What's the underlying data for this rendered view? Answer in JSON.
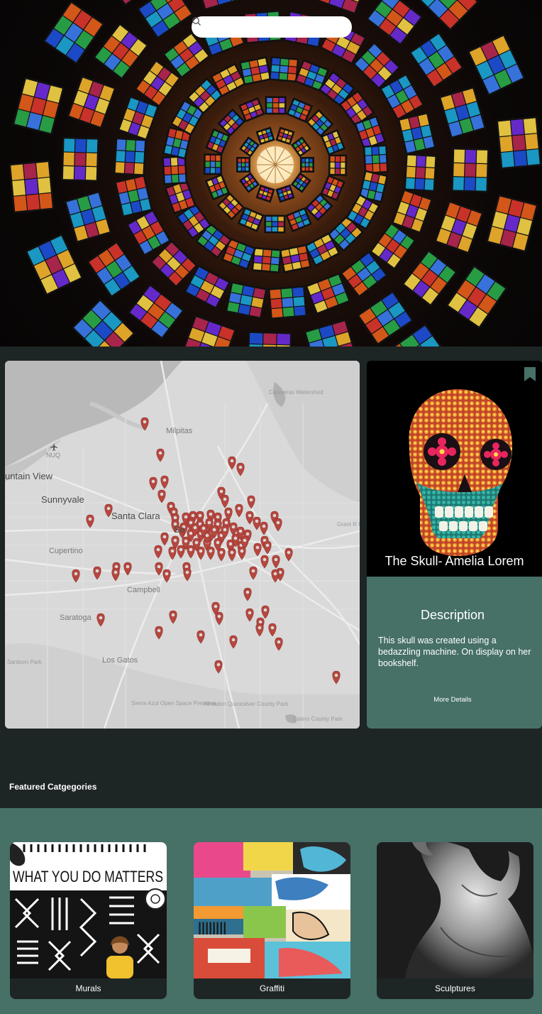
{
  "search": {
    "placeholder": "",
    "value": ""
  },
  "map": {
    "labels": {
      "calaveras": "Calaveras Watershed",
      "milpitas": "Milpitas",
      "nuq": "NUQ",
      "mountain_view": "untain View",
      "sunnyvale": "Sunnyvale",
      "santa_clara": "Santa Clara",
      "san_jose": "Sa",
      "cupertino": "Cupertino",
      "grant_ranch": "Grant R County",
      "campbell": "Campbell",
      "saratoga": "Saratoga",
      "sanborn": "Sanborn Park",
      "los_gatos": "Los Gatos",
      "sierra_azul": "Sierra Azul Open Space Preserve",
      "almaden": "Almaden Quicksilver County Park",
      "calero": "Calero County Park"
    },
    "marker_color": "#b6473f"
  },
  "featured_card": {
    "title": "The Skull- Amelia Lorem",
    "description_heading": "Description",
    "description": "This skull was created using a bedazzling machine. On display on her bookshelf.",
    "more_details": "More Details"
  },
  "featured_categories": {
    "heading": "Featured Catgegories",
    "items": [
      {
        "label": "Murals",
        "mural_text": "WHAT YOU DO MATTERS"
      },
      {
        "label": "Graffiti"
      },
      {
        "label": "Sculptures"
      }
    ]
  },
  "colors": {
    "background": "#1e2525",
    "teal": "#477067",
    "marker": "#b6473f"
  }
}
